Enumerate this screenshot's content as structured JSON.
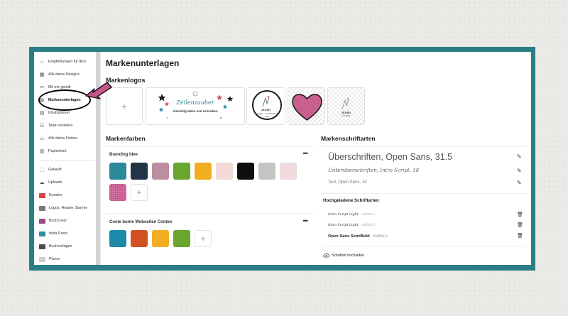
{
  "sidebar": {
    "items": [
      {
        "label": "Empfehlungen für dich",
        "icon": "home-icon"
      },
      {
        "label": "Alle deine Designs",
        "icon": "grid-icon"
      },
      {
        "label": "Mit mir geteilt",
        "icon": "shared-icon"
      },
      {
        "label": "Markenunterlagen",
        "icon": "brand-icon"
      },
      {
        "label": "Inhaltsplaner",
        "icon": "calendar-icon"
      },
      {
        "label": "Team erstellen",
        "icon": "team-icon"
      },
      {
        "label": "Alle deine Ordner",
        "icon": "folder-icon"
      },
      {
        "label": "Papierkorb",
        "icon": "trash-icon"
      },
      {
        "label": "Gekauft",
        "icon": "purchased-icon"
      },
      {
        "label": "Uploads",
        "icon": "cloud-icon"
      },
      {
        "label": "Kunden",
        "icon": "folder-thumb-icon"
      },
      {
        "label": "Logos, Header, Banner",
        "icon": "folder-thumb-icon"
      },
      {
        "label": "Buchcover",
        "icon": "folder-thumb-icon"
      },
      {
        "label": "Insta Posts",
        "icon": "folder-thumb-icon"
      },
      {
        "label": "Buchvorlagen",
        "icon": "folder-thumb-icon"
      },
      {
        "label": "Planer",
        "icon": "folder-thumb-icon"
      }
    ],
    "thumb_colors": [
      "#d64545",
      "#7a7a7a",
      "#9a4d7d",
      "#2a8fa0",
      "#4c4c4c",
      "#cfcfcf"
    ]
  },
  "main": {
    "title": "Markenunterlagen",
    "logos_heading": "Markenlogos",
    "logo1": {
      "title": "Zeilenzauber",
      "subtitle": "Vielseitig leben und schreiben"
    },
    "logo2": {
      "line1": "ZEILEN",
      "line2": "ZAUBER · SCHREIBEN"
    },
    "logo4": {
      "line1": "ZEILEN",
      "line2": "ZAUBER"
    },
    "colors_heading": "Markenfarben",
    "fonts_heading": "Markenschriftarten"
  },
  "color_kits": [
    {
      "name": "Branding Idee",
      "colors": [
        "#2a8a9a",
        "#243447",
        "#bb8fa0",
        "#6aa52e",
        "#f2ad21",
        "#f4dad6",
        "#0f0f0f",
        "#c4c4c4",
        "#f0dcdc",
        "#c95f93"
      ]
    },
    {
      "name": "Coole bunte Webseiten Combo",
      "colors": [
        "#1c8aa8",
        "#d35023",
        "#f2ad21",
        "#6aa52e"
      ]
    }
  ],
  "fonts": {
    "heading": "Überschriften, Open Sans, 31.5",
    "subheading": "Unterüberschriften, Intro Script, 18",
    "body": "Text, Open Sans, 14",
    "uploaded_heading": "Hochgeladene Schriftarten",
    "uploaded": [
      {
        "name": "Intro Script Light",
        "sample": "AaBbCc"
      },
      {
        "name": "Intro Script Light",
        "sample": "AaBbCc"
      },
      {
        "name": "Open Sans SemiBold",
        "sample": "AaBbCc"
      }
    ],
    "upload_button": "Schriftart hochladen"
  },
  "colors": {
    "frame": "#2a7e86",
    "annotation_arrow": "#c9568b"
  }
}
